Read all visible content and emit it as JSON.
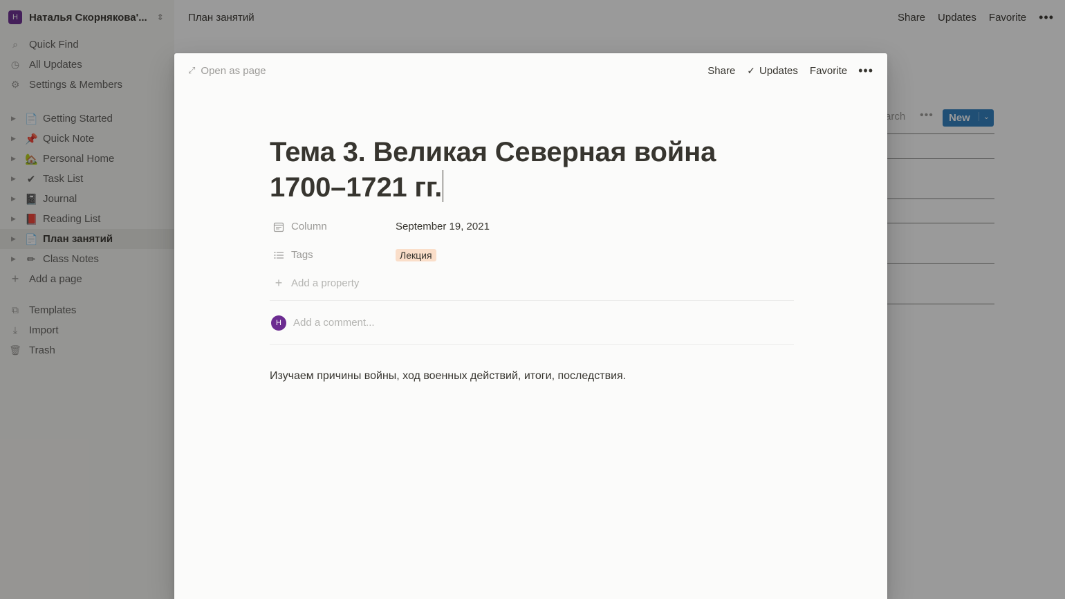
{
  "workspace": {
    "avatar": "Н",
    "name": "Наталья Скорнякова'...",
    "toggle_icon": "chevron-updown-icon"
  },
  "sidebar": {
    "nav": [
      {
        "label": "Quick Find",
        "icon": "search-icon",
        "glyph": "⌕"
      },
      {
        "label": "All Updates",
        "icon": "clock-icon",
        "glyph": "◷"
      },
      {
        "label": "Settings & Members",
        "icon": "gear-icon",
        "glyph": "⚙"
      }
    ],
    "pages": [
      {
        "label": "Getting Started",
        "emoji": "📄"
      },
      {
        "label": "Quick Note",
        "emoji": "📌"
      },
      {
        "label": "Personal Home",
        "emoji": "🏡"
      },
      {
        "label": "Task List",
        "emoji": "✔"
      },
      {
        "label": "Journal",
        "emoji": "📓"
      },
      {
        "label": "Reading List",
        "emoji": "📕"
      },
      {
        "label": "План занятий",
        "emoji": "📄",
        "active": true
      },
      {
        "label": "Class Notes",
        "emoji": "✏"
      }
    ],
    "add_page": "Add a page",
    "bottom": [
      {
        "label": "Templates",
        "icon": "templates-icon",
        "glyph": "⧉"
      },
      {
        "label": "Import",
        "icon": "import-icon",
        "glyph": "⤓"
      },
      {
        "label": "Trash",
        "icon": "trash-icon",
        "glyph": "🗑"
      }
    ]
  },
  "topbar": {
    "breadcrumb": "План занятий",
    "share": "Share",
    "updates": "Updates",
    "favorite": "Favorite",
    "more": "•••"
  },
  "database": {
    "search_fragment": "arch",
    "more": "•••",
    "new_label": "New",
    "new_caret": "⌄"
  },
  "modal": {
    "open_as_page": "Open as page",
    "share": "Share",
    "updates": "Updates",
    "favorite": "Favorite",
    "more": "•••",
    "title": "Тема 3. Великая Северная война 1700–1721 гг.",
    "properties": {
      "column": {
        "name": "Column",
        "value": "September 19, 2021"
      },
      "tags": {
        "name": "Tags",
        "value": "Лекция",
        "color": "#fadec9"
      }
    },
    "add_property": "Add a property",
    "comment": {
      "avatar": "Н",
      "placeholder": "Add a comment..."
    },
    "body": "Изучаем причины войны, ход военных действий, итоги, последствия."
  },
  "colors": {
    "accent": "#2e7fbf",
    "avatar": "#6c2c91",
    "tag": "#fadec9"
  }
}
